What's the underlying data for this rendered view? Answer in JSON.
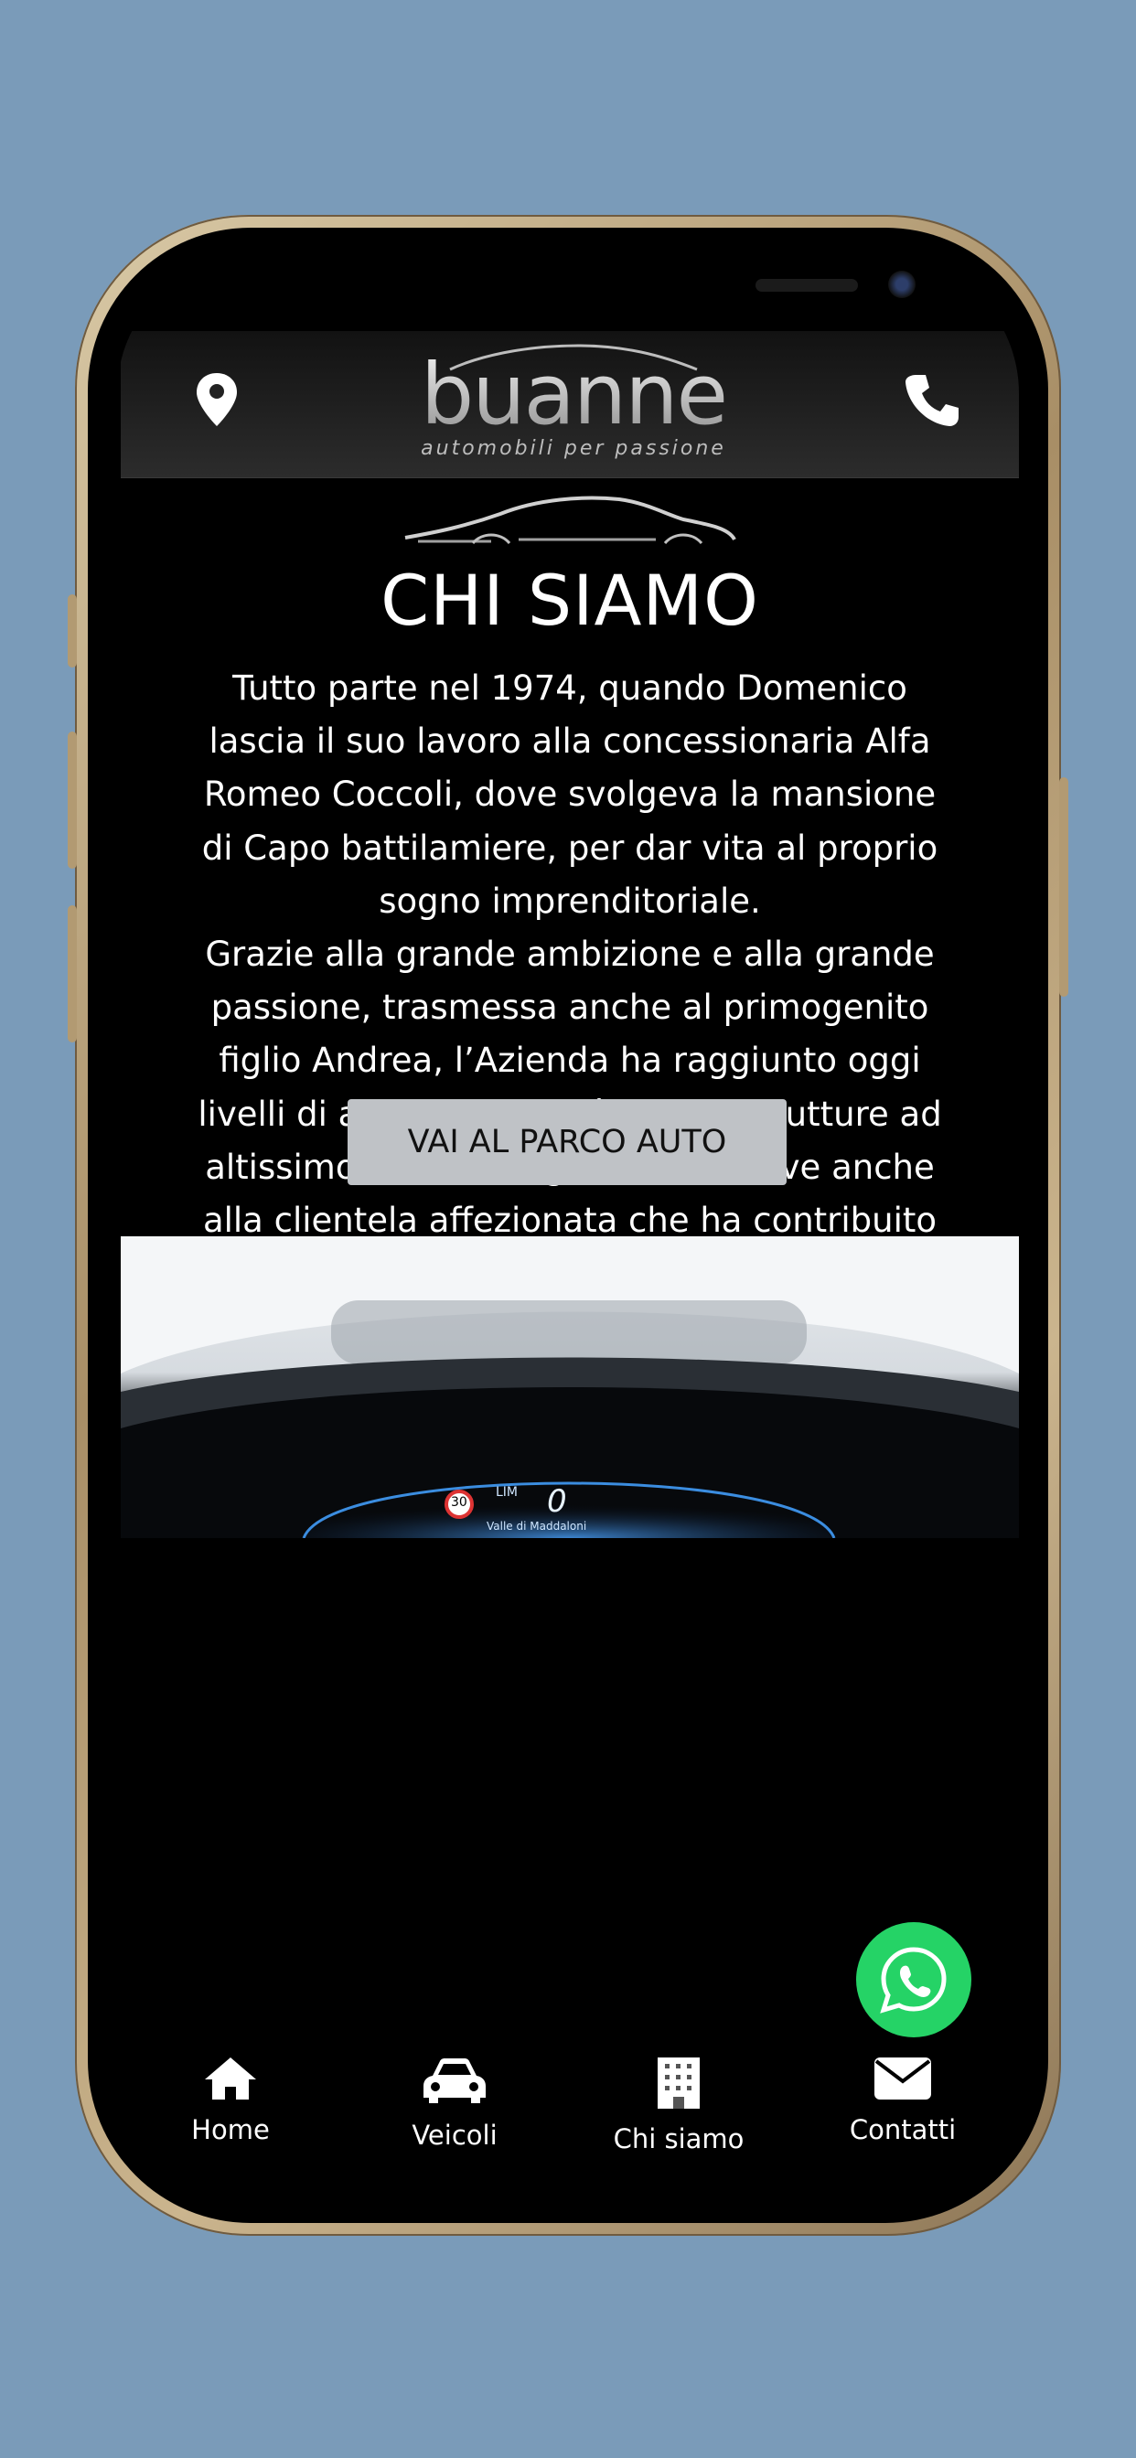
{
  "header": {
    "logo_text": "buanne",
    "logo_tagline": "automobili per passione",
    "location_icon": "map-pin-icon",
    "phone_icon": "phone-icon"
  },
  "about": {
    "title": "CHI SIAMO",
    "paragraph_1": "Tutto parte nel 1974, quando Domenico lascia il suo lavoro alla concessionaria Alfa Romeo Coccoli, dove svolgeva la mansione di Capo battilamiere, per dar vita al proprio sogno imprenditoriale.",
    "paragraph_2": "Grazie alla grande ambizione e alla grande passione, trasmessa anche al primogenito figlio Andrea, l’Azienda ha raggiunto oggi livelli di alta competività in due strutture ad altissimo livello. Un grazie lo si deve anche alla clientela affezionata che ha contribuito a far sì che il sogno di diventare azienda leader nel settore dell’usato e del nuovo si coronasse.",
    "cta_label": "VAI AL PARCO AUTO"
  },
  "dashboard_photo": {
    "speed_limit": "30",
    "lim_label": "LIM",
    "speed": "0",
    "location_text": "Valle di Maddaloni"
  },
  "whatsapp": {
    "icon": "whatsapp-icon"
  },
  "bottom_nav": {
    "items": [
      {
        "label": "Home",
        "icon": "home-icon"
      },
      {
        "label": "Veicoli",
        "icon": "car-icon"
      },
      {
        "label": "Chi siamo",
        "icon": "building-icon"
      },
      {
        "label": "Contatti",
        "icon": "envelope-icon"
      }
    ]
  },
  "colors": {
    "background": "#7a9bb9",
    "screen": "#000000",
    "cta_bg": "#bfc2c6",
    "whatsapp": "#25d366"
  }
}
